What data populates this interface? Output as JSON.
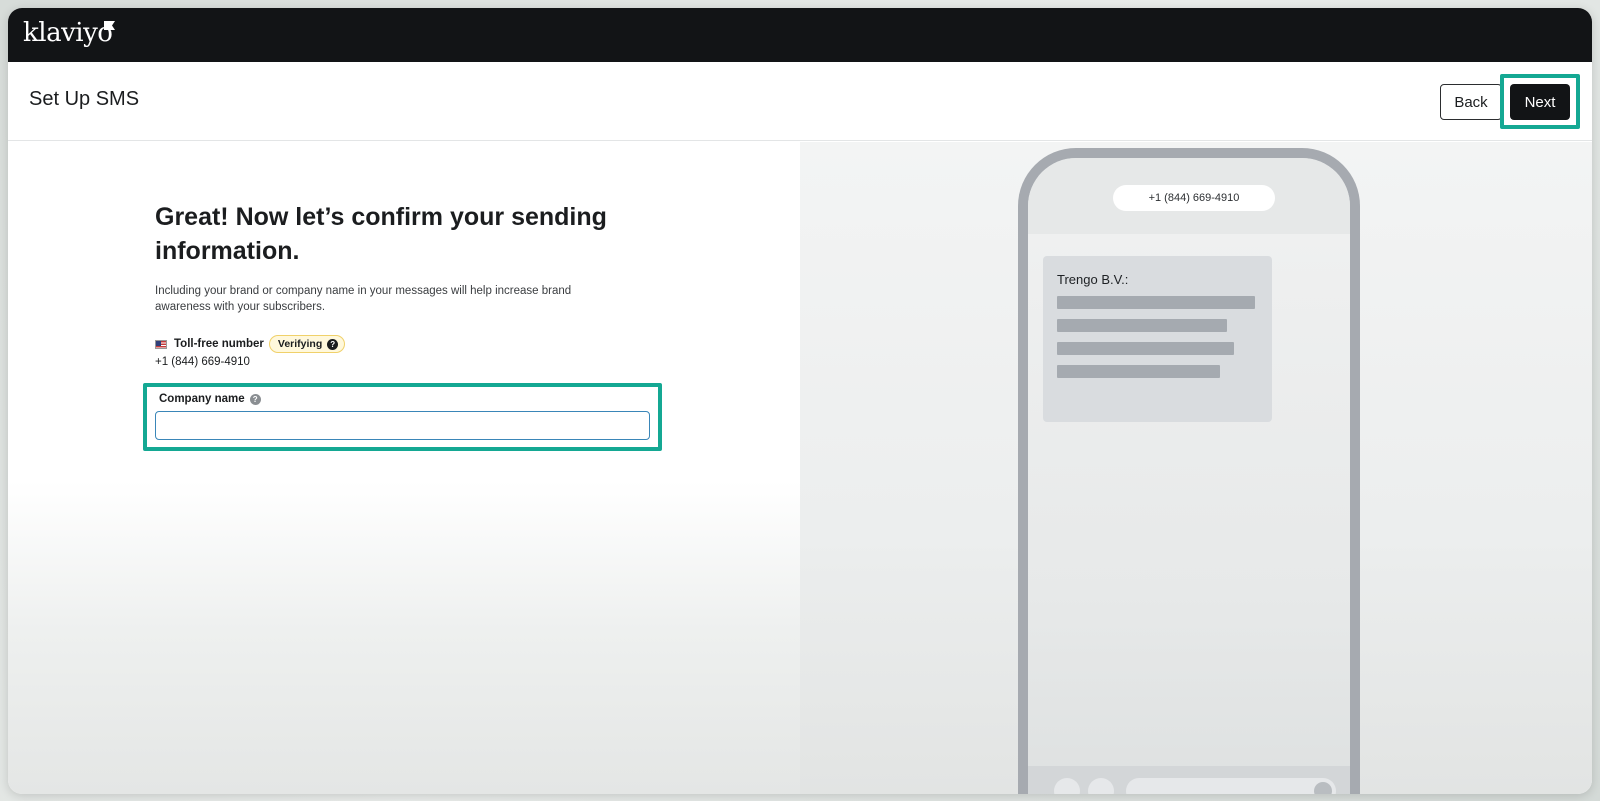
{
  "app": {
    "logo": "klaviyo"
  },
  "header": {
    "title": "Set Up SMS",
    "back_label": "Back",
    "next_label": "Next"
  },
  "form": {
    "heading": "Great! Now let’s confirm your sending information.",
    "subtext": "Including your brand or company name in your messages will help increase brand awareness with your subscribers.",
    "tollfree_label": "Toll-free number",
    "tollfree_status": "Verifying",
    "tollfree_number": "+1 (844) 669-4910",
    "company_label": "Company name",
    "company_value": ""
  },
  "preview": {
    "phone_number": "+1 (844) 669-4910",
    "sender": "Trengo B.V.:"
  },
  "colors": {
    "topbar": "#121416",
    "highlight": "#14a893",
    "badge_border": "#f0d16a",
    "input_border": "#3a86b8"
  }
}
